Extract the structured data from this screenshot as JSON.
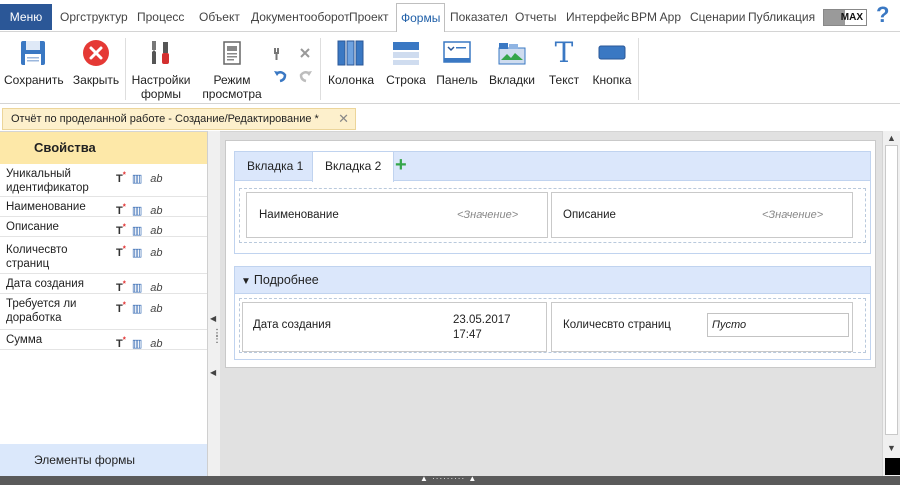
{
  "menu": {
    "menu_button": "Меню",
    "tabs": [
      {
        "label": "Оргструктур"
      },
      {
        "label": "Процесс"
      },
      {
        "label": "Объект"
      },
      {
        "label": "Документооборот"
      },
      {
        "label": "Проект"
      },
      {
        "label": "Формы",
        "active": true
      },
      {
        "label": "Показател"
      },
      {
        "label": "Отчеты"
      },
      {
        "label": "Интерфейс"
      },
      {
        "label": "BPM App"
      },
      {
        "label": "Сценарии"
      },
      {
        "label": "Публикация"
      }
    ],
    "max_toggle": "MAX",
    "help_icon": "?"
  },
  "ribbon": {
    "save": "Сохранить",
    "close": "Закрыть",
    "form_settings_1": "Настройки",
    "form_settings_2": "формы",
    "preview_1": "Режим",
    "preview_2": "просмотра",
    "column": "Колонка",
    "row": "Строка",
    "panel": "Панель",
    "tabs": "Вкладки",
    "text": "Текст",
    "button": "Кнопка",
    "text_icon_glyph": "T"
  },
  "document_tab": {
    "title": "Отчёт по проделанной работе - Создание/Редактирование *",
    "close_icon": "✕"
  },
  "left_panel": {
    "header": "Свойства",
    "footer": "Элементы формы",
    "properties": [
      {
        "name_1": "Уникальный",
        "name_2": "идентификатор"
      },
      {
        "name_1": "Наименование",
        "name_2": ""
      },
      {
        "name_1": "Описание",
        "name_2": ""
      },
      {
        "name_1": "Количесвто",
        "name_2": "страниц"
      },
      {
        "name_1": "Дата создания",
        "name_2": ""
      },
      {
        "name_1": "Требуется ли",
        "name_2": "доработка"
      },
      {
        "name_1": "Сумма",
        "name_2": ""
      }
    ],
    "icon_t": "T",
    "icon_t_sup": "*",
    "icon_b": "▥",
    "icon_ab": "ab"
  },
  "form": {
    "tabs": [
      {
        "label": "Вкладка 1"
      },
      {
        "label": "Вкладка 2",
        "active": true
      }
    ],
    "tab_add": "+",
    "fields_row1": [
      {
        "label": "Наименование",
        "placeholder": "<Значение>"
      },
      {
        "label": "Описание",
        "placeholder": "<Значение>"
      }
    ],
    "section_title": "Подробнее",
    "created_label": "Дата создания",
    "created_date": "23.05.2017",
    "created_time": "17:47",
    "pages_label": "Количесвто страниц",
    "pages_value": "Пусто"
  },
  "colors": {
    "menu_accent": "#2b5797",
    "active_tab_text": "#1f5fa8",
    "doc_tab_bg": "#fdf0cc",
    "props_header_bg": "#fde8a8",
    "section_bg": "#dbe7fb",
    "add_green": "#35a64a",
    "close_red": "#e53935"
  }
}
